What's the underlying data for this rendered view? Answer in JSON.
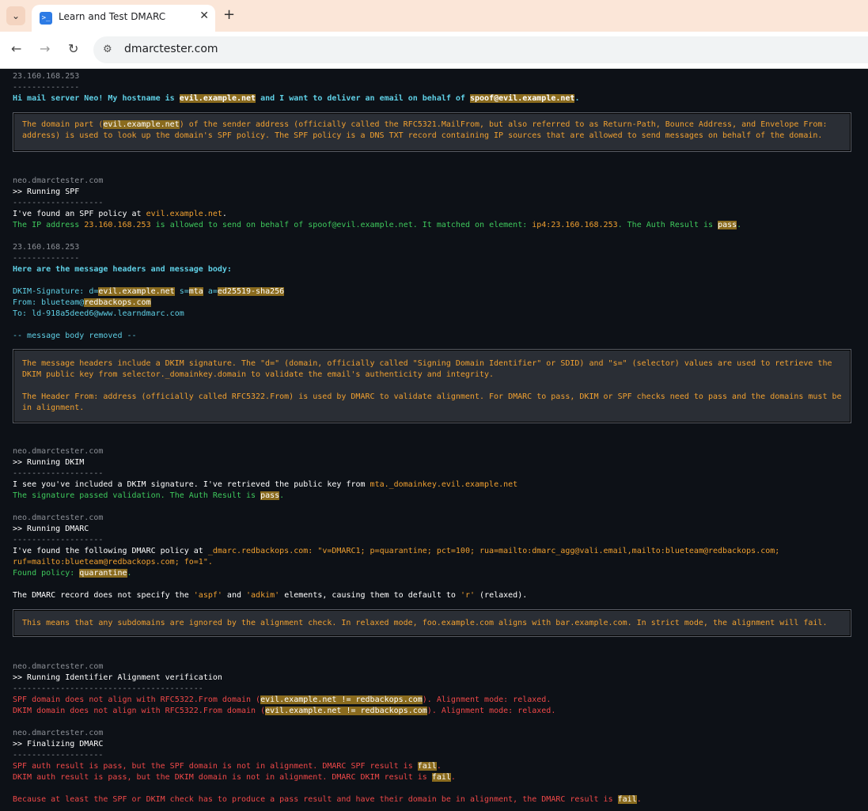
{
  "browser": {
    "tab_title": "Learn and Test DMARC",
    "url": "dmarctester.com",
    "new_tab": "+",
    "close": "✕"
  },
  "log": {
    "ip1": "23.160.168.253",
    "dashes_short": "--------------",
    "greet_a": "Hi mail server Neo! My hostname is ",
    "greet_host": "evil.example.net",
    "greet_b": " and I want to deliver an email on behalf of ",
    "greet_sender": "spoof@evil.example.net",
    "greet_c": ".",
    "note1_a": "The domain part (",
    "note1_hl": "evil.example.net",
    "note1_b": ") of the sender address (officially called the RFC5321.MailFrom, but also referred to as Return-Path, Bounce Address, and Envelope From: address) is used to look up the domain's SPF policy. The SPF policy is a DNS TXT record containing IP sources that are allowed to send messages on behalf of the domain.",
    "neo": "neo.dmarctester.com",
    "running_spf": ">> Running SPF",
    "dashes_long": "-------------------",
    "spf_found_a": "I've found an SPF policy at ",
    "spf_found_b": "evil.example.net",
    "spf_found_c": ".",
    "spf_allowed_a": "The IP address ",
    "spf_allowed_ip": "23.160.168.253",
    "spf_allowed_b": " is allowed to send on behalf of spoof@evil.example.net. It matched on element: ",
    "spf_allowed_el": "ip4:23.160.168.253",
    "spf_allowed_c": ". The Auth Result is ",
    "pass": "pass",
    "dot": ".",
    "headers_intro": "Here are the message headers and message body:",
    "dkim_sig_a": "DKIM-Signature: d=",
    "dkim_sig_d": "evil.example.net",
    "dkim_sig_b": " s=",
    "dkim_sig_s": "mta",
    "dkim_sig_c": " a=",
    "dkim_sig_alg": "ed25519-sha256",
    "from_a": "From: blueteam@",
    "from_domain": "redbackops.com",
    "to_line": "To: ld-918a5deed6@www.learndmarc.com",
    "body_removed": "-- message body removed --",
    "note2_p1": "The message headers include a DKIM signature. The \"d=\" (domain, officially called \"Signing Domain Identifier\" or SDID) and \"s=\" (selector) values are used to retrieve the DKIM public key from selector._domainkey.domain to validate the email's authenticity and integrity.",
    "note2_p2": "The Header From: address (officially called RFC5322.From) is used by DMARC to validate alignment. For DMARC to pass, DKIM or SPF checks need to pass and the domains must be in alignment.",
    "running_dkim": ">> Running DKIM",
    "dkim_see_a": "I see you've included a DKIM signature. I've retrieved the public key from ",
    "dkim_see_b": "mta._domainkey.evil.example.net",
    "dkim_passed_a": "The signature passed validation. The Auth Result is ",
    "running_dmarc": ">> Running DMARC",
    "dmarc_found_a": "I've found the following DMARC policy at ",
    "dmarc_found_b": "_dmarc.redbackops.com: \"v=DMARC1; p=quarantine; pct=100; rua=mailto:dmarc_agg@vali.email,mailto:blueteam@redbackops.com;",
    "dmarc_found_c": "ruf=mailto:blueteam@redbackops.com; fo=1\".",
    "found_policy_a": "Found policy: ",
    "found_policy_b": "quarantine",
    "aspf_a": "The DMARC record does not specify the ",
    "aspf_b": "'aspf'",
    "aspf_c": " and ",
    "aspf_d": "'adkim'",
    "aspf_e": " elements, causing them to default to ",
    "aspf_f": "'r'",
    "aspf_g": " (relaxed).",
    "note3": "This means that any subdomains are ignored by the alignment check. In relaxed mode, foo.example.com aligns with bar.example.com. In strict mode, the alignment will fail.",
    "running_align": ">> Running Identifier Alignment verification",
    "dashes_align": "----------------------------------------",
    "spf_align_a": "SPF domain does not align with RFC5322.From domain (",
    "align_hl": "evil.example.net != redbackops.com",
    "spf_align_b": "). Alignment mode: relaxed.",
    "dkim_align_a": "DKIM domain does not align with RFC5322.From domain (",
    "finalizing": ">> Finalizing DMARC",
    "final_spf_a": "SPF auth result is pass, but the SPF domain is not in alignment. DMARC SPF result is ",
    "fail": "fail",
    "final_dkim_a": "DKIM auth result is pass, but the DKIM domain is not in alignment. DMARC DKIM result is ",
    "final_dmarc_a": "Because at least the SPF or DKIM check has to produce a pass result and have their domain be in alignment, the DMARC result is "
  }
}
